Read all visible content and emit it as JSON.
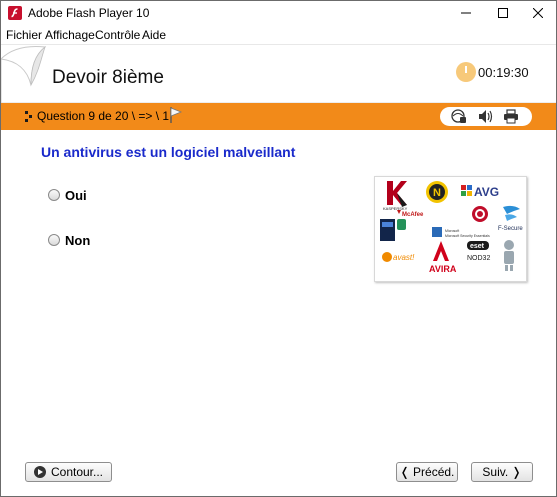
{
  "window": {
    "title": "Adobe Flash Player 10"
  },
  "menu": {
    "items": [
      "Fichier",
      "Affichage",
      "Contrôle",
      "Aide"
    ]
  },
  "header": {
    "title": "Devoir 8ième",
    "timer": "00:19:30"
  },
  "toolbar": {
    "question_counter": "Question 9 de 20 \\ => \\ 1",
    "icons": [
      "help-icon",
      "sound-icon",
      "print-icon"
    ]
  },
  "question": {
    "text": "Un antivirus est un logiciel malveillant",
    "options": [
      "Oui",
      "Non"
    ],
    "image_logos": [
      "KASPERSKY",
      "N",
      "AVG",
      "McAfee",
      "F-Secure",
      "Microsoft Security Essentials",
      "avast!",
      "AVIRA",
      "eset",
      "NOD32"
    ]
  },
  "footer": {
    "contour_label": "Contour...",
    "prev_label": "❬ Précéd.",
    "next_label": "Suiv. ❭"
  },
  "colors": {
    "accent_orange": "#f28a19",
    "question_blue": "#1a2acb",
    "flash_red": "#c8102e"
  }
}
